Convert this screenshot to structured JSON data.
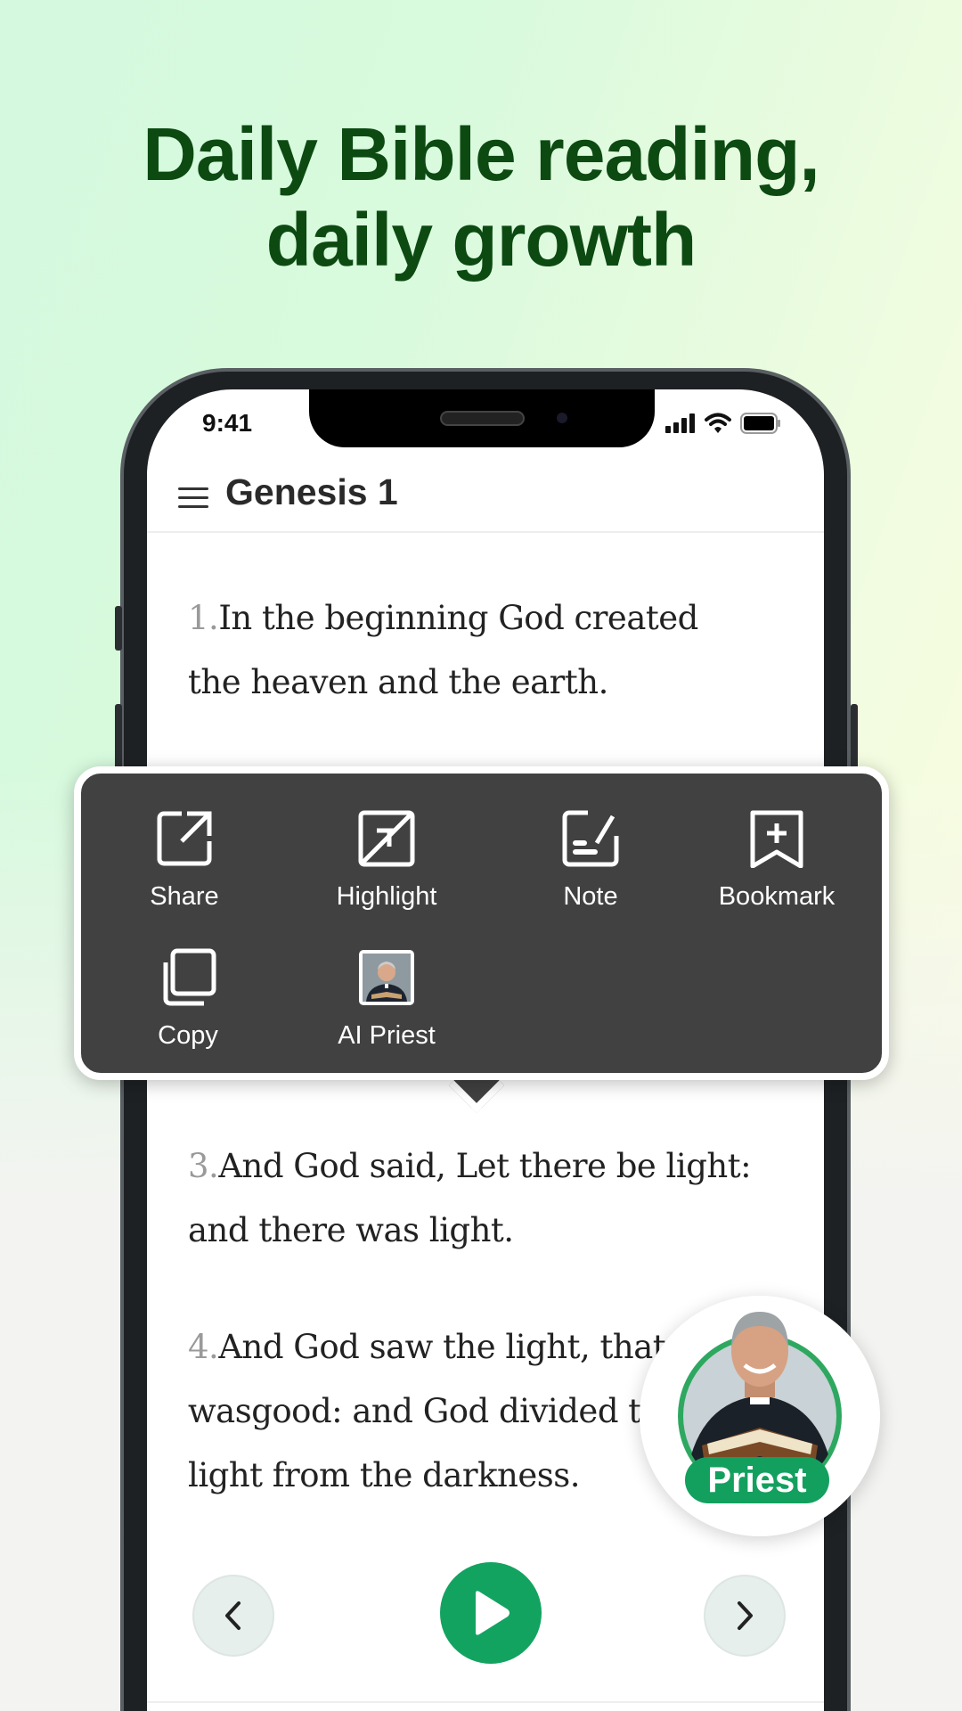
{
  "headline": {
    "line1": "Daily Bible reading,",
    "line2": "daily growth"
  },
  "status_bar": {
    "time": "9:41"
  },
  "header": {
    "title": "Genesis 1",
    "menu_icon": "hamburger-icon"
  },
  "verses": [
    {
      "num": "1.",
      "line1": "In the beginning God created",
      "line2": "the heaven and the earth."
    },
    {
      "num": "3.",
      "line1": "And God said, Let there be light:",
      "line2": "and there was light."
    },
    {
      "num": "4.",
      "line1": "And God saw the light, that it",
      "line2": "wasgood: and God divided the",
      "line3": "light from the darkness."
    }
  ],
  "popup_menu": {
    "items": [
      {
        "label": "Share",
        "icon": "share-icon"
      },
      {
        "label": "Highlight",
        "icon": "highlight-icon"
      },
      {
        "label": "Note",
        "icon": "note-icon"
      },
      {
        "label": "Bookmark",
        "icon": "bookmark-add-icon"
      },
      {
        "label": "Copy",
        "icon": "copy-icon"
      },
      {
        "label": "AI Priest",
        "icon": "priest-avatar"
      }
    ]
  },
  "priest_button": {
    "label": "Priest"
  },
  "colors": {
    "headline": "#0c4a12",
    "accent": "#13a360",
    "popup_bg": "#414141"
  }
}
